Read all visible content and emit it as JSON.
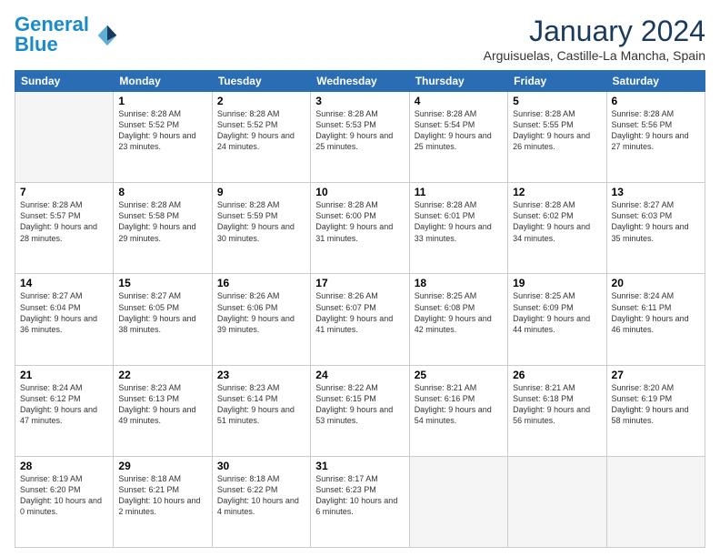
{
  "header": {
    "logo_general": "General",
    "logo_blue": "Blue",
    "month_title": "January 2024",
    "location": "Arguisuelas, Castille-La Mancha, Spain"
  },
  "days_of_week": [
    "Sunday",
    "Monday",
    "Tuesday",
    "Wednesday",
    "Thursday",
    "Friday",
    "Saturday"
  ],
  "weeks": [
    [
      {
        "day": "",
        "sunrise": "",
        "sunset": "",
        "daylight": ""
      },
      {
        "day": "1",
        "sunrise": "8:28 AM",
        "sunset": "5:52 PM",
        "daylight": "9 hours and 23 minutes."
      },
      {
        "day": "2",
        "sunrise": "8:28 AM",
        "sunset": "5:52 PM",
        "daylight": "9 hours and 24 minutes."
      },
      {
        "day": "3",
        "sunrise": "8:28 AM",
        "sunset": "5:53 PM",
        "daylight": "9 hours and 25 minutes."
      },
      {
        "day": "4",
        "sunrise": "8:28 AM",
        "sunset": "5:54 PM",
        "daylight": "9 hours and 25 minutes."
      },
      {
        "day": "5",
        "sunrise": "8:28 AM",
        "sunset": "5:55 PM",
        "daylight": "9 hours and 26 minutes."
      },
      {
        "day": "6",
        "sunrise": "8:28 AM",
        "sunset": "5:56 PM",
        "daylight": "9 hours and 27 minutes."
      }
    ],
    [
      {
        "day": "7",
        "sunrise": "8:28 AM",
        "sunset": "5:57 PM",
        "daylight": "9 hours and 28 minutes."
      },
      {
        "day": "8",
        "sunrise": "8:28 AM",
        "sunset": "5:58 PM",
        "daylight": "9 hours and 29 minutes."
      },
      {
        "day": "9",
        "sunrise": "8:28 AM",
        "sunset": "5:59 PM",
        "daylight": "9 hours and 30 minutes."
      },
      {
        "day": "10",
        "sunrise": "8:28 AM",
        "sunset": "6:00 PM",
        "daylight": "9 hours and 31 minutes."
      },
      {
        "day": "11",
        "sunrise": "8:28 AM",
        "sunset": "6:01 PM",
        "daylight": "9 hours and 33 minutes."
      },
      {
        "day": "12",
        "sunrise": "8:28 AM",
        "sunset": "6:02 PM",
        "daylight": "9 hours and 34 minutes."
      },
      {
        "day": "13",
        "sunrise": "8:27 AM",
        "sunset": "6:03 PM",
        "daylight": "9 hours and 35 minutes."
      }
    ],
    [
      {
        "day": "14",
        "sunrise": "8:27 AM",
        "sunset": "6:04 PM",
        "daylight": "9 hours and 36 minutes."
      },
      {
        "day": "15",
        "sunrise": "8:27 AM",
        "sunset": "6:05 PM",
        "daylight": "9 hours and 38 minutes."
      },
      {
        "day": "16",
        "sunrise": "8:26 AM",
        "sunset": "6:06 PM",
        "daylight": "9 hours and 39 minutes."
      },
      {
        "day": "17",
        "sunrise": "8:26 AM",
        "sunset": "6:07 PM",
        "daylight": "9 hours and 41 minutes."
      },
      {
        "day": "18",
        "sunrise": "8:25 AM",
        "sunset": "6:08 PM",
        "daylight": "9 hours and 42 minutes."
      },
      {
        "day": "19",
        "sunrise": "8:25 AM",
        "sunset": "6:09 PM",
        "daylight": "9 hours and 44 minutes."
      },
      {
        "day": "20",
        "sunrise": "8:24 AM",
        "sunset": "6:11 PM",
        "daylight": "9 hours and 46 minutes."
      }
    ],
    [
      {
        "day": "21",
        "sunrise": "8:24 AM",
        "sunset": "6:12 PM",
        "daylight": "9 hours and 47 minutes."
      },
      {
        "day": "22",
        "sunrise": "8:23 AM",
        "sunset": "6:13 PM",
        "daylight": "9 hours and 49 minutes."
      },
      {
        "day": "23",
        "sunrise": "8:23 AM",
        "sunset": "6:14 PM",
        "daylight": "9 hours and 51 minutes."
      },
      {
        "day": "24",
        "sunrise": "8:22 AM",
        "sunset": "6:15 PM",
        "daylight": "9 hours and 53 minutes."
      },
      {
        "day": "25",
        "sunrise": "8:21 AM",
        "sunset": "6:16 PM",
        "daylight": "9 hours and 54 minutes."
      },
      {
        "day": "26",
        "sunrise": "8:21 AM",
        "sunset": "6:18 PM",
        "daylight": "9 hours and 56 minutes."
      },
      {
        "day": "27",
        "sunrise": "8:20 AM",
        "sunset": "6:19 PM",
        "daylight": "9 hours and 58 minutes."
      }
    ],
    [
      {
        "day": "28",
        "sunrise": "8:19 AM",
        "sunset": "6:20 PM",
        "daylight": "10 hours and 0 minutes."
      },
      {
        "day": "29",
        "sunrise": "8:18 AM",
        "sunset": "6:21 PM",
        "daylight": "10 hours and 2 minutes."
      },
      {
        "day": "30",
        "sunrise": "8:18 AM",
        "sunset": "6:22 PM",
        "daylight": "10 hours and 4 minutes."
      },
      {
        "day": "31",
        "sunrise": "8:17 AM",
        "sunset": "6:23 PM",
        "daylight": "10 hours and 6 minutes."
      },
      {
        "day": "",
        "sunrise": "",
        "sunset": "",
        "daylight": ""
      },
      {
        "day": "",
        "sunrise": "",
        "sunset": "",
        "daylight": ""
      },
      {
        "day": "",
        "sunrise": "",
        "sunset": "",
        "daylight": ""
      }
    ]
  ]
}
